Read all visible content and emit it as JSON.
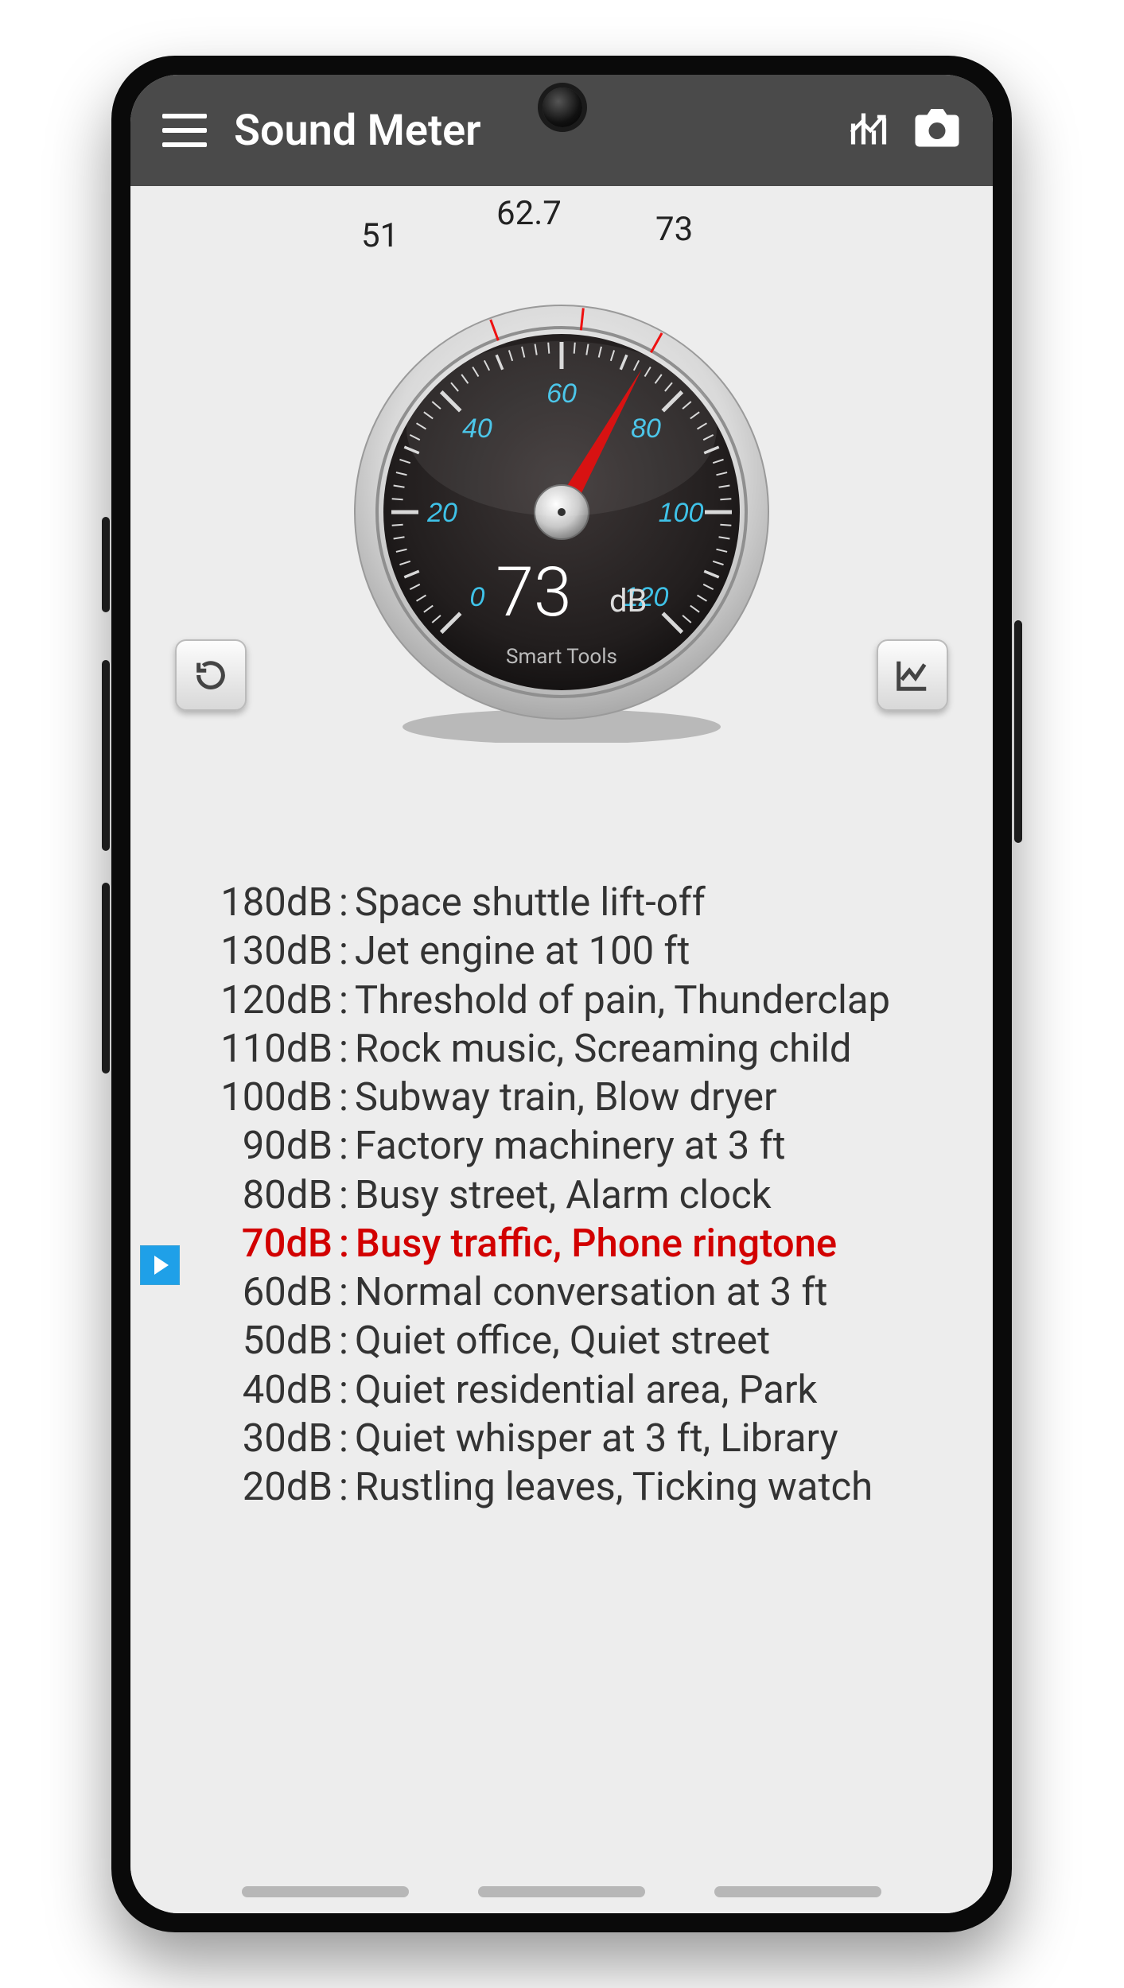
{
  "frame": {
    "device": "phone",
    "chrome_color": "#0a0a0a",
    "screen_bg": "#ededed"
  },
  "appbar": {
    "bg": "#4a4a4a",
    "title": "Sound Meter",
    "icons": [
      "menu",
      "stats",
      "camera"
    ]
  },
  "gauge": {
    "min": 0,
    "max": 120,
    "ticks": [
      0,
      20,
      40,
      60,
      80,
      100,
      120
    ],
    "tick_color": "#3fb2d6",
    "current_value": 73,
    "unit": "dB",
    "footer_label": "Smart Tools",
    "indicators": {
      "min_marker": 51,
      "avg_marker": 62.7,
      "max_marker": 73
    },
    "needle_color": "#d60000",
    "face_color_outer": "#d5d5d5",
    "face_color_inner": "#2a2626"
  },
  "side_buttons": {
    "left": "refresh",
    "right": "chart"
  },
  "db_reference": {
    "highlight_db": 70,
    "highlight_color": "#d20000",
    "rows": [
      {
        "db": 180,
        "label": "Space shuttle lift-off"
      },
      {
        "db": 130,
        "label": "Jet engine at 100 ft"
      },
      {
        "db": 120,
        "label": "Threshold of pain, Thunderclap"
      },
      {
        "db": 110,
        "label": "Rock music, Screaming child"
      },
      {
        "db": 100,
        "label": "Subway train, Blow dryer"
      },
      {
        "db": 90,
        "label": "Factory machinery at 3 ft"
      },
      {
        "db": 80,
        "label": "Busy street, Alarm clock"
      },
      {
        "db": 70,
        "label": "Busy traffic, Phone ringtone"
      },
      {
        "db": 60,
        "label": "Normal conversation at 3 ft"
      },
      {
        "db": 50,
        "label": "Quiet office, Quiet street"
      },
      {
        "db": 40,
        "label": "Quiet residential area, Park"
      },
      {
        "db": 30,
        "label": "Quiet whisper at 3 ft, Library"
      },
      {
        "db": 20,
        "label": "Rustling leaves, Ticking watch"
      }
    ]
  }
}
